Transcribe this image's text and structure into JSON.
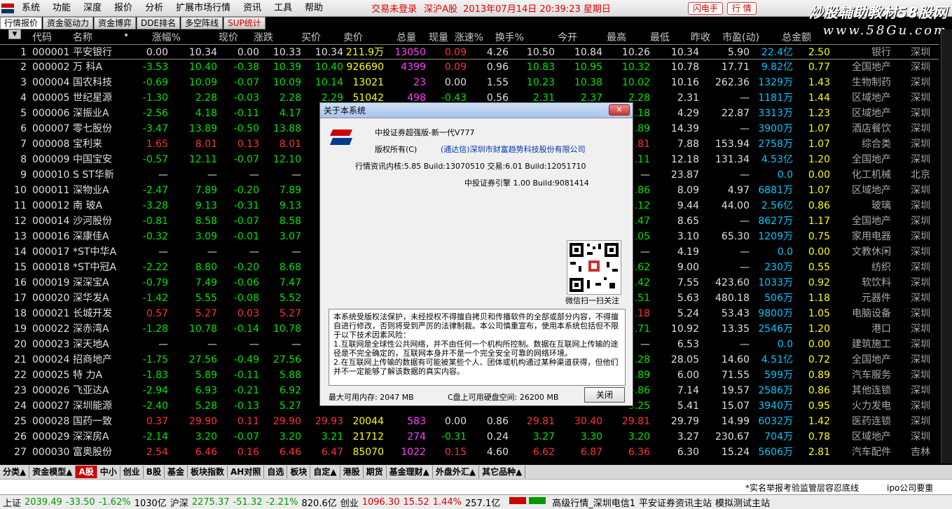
{
  "menubar": {
    "items": [
      "系统",
      "功能",
      "深度",
      "报价",
      "分析",
      "扩展市场行情",
      "资讯",
      "工具",
      "帮助"
    ],
    "login_status": "交易未登录",
    "market": "深沪A股",
    "datetime": "2013年07月14日  20:39:23 星期日",
    "btn_phone": "闪电手",
    "btn_quote": "行 情"
  },
  "brand": {
    "text": "炒股辅助教材58股网",
    "url": "www.58Gu.com"
  },
  "tabs": [
    {
      "label": "行情报价"
    },
    {
      "label": "资金驱动力"
    },
    {
      "label": "资金博弈"
    },
    {
      "label": "DDE排名"
    },
    {
      "label": "多空阵线"
    },
    {
      "label": "SUP统计"
    }
  ],
  "columns": [
    "代码",
    "名称",
    "•",
    "涨幅%",
    "现价",
    "涨跌",
    "买价",
    "卖价",
    "总量",
    "现量",
    "涨速%",
    "换手%",
    "今开",
    "最高",
    "最低",
    "昨收",
    "市盈(动)",
    "总金额"
  ],
  "stocks": [
    [
      "1",
      "000001",
      "平安银行",
      "0.00",
      "10.34",
      "0.00",
      "10.33",
      "10.34",
      "211.9万",
      "13050",
      "0.09",
      "4.26",
      "10.50",
      "10.84",
      "10.26",
      "10.34",
      "5.90",
      "22.4亿",
      "2.50",
      "银行",
      "深圳"
    ],
    [
      "2",
      "000002",
      "万  科A",
      "-3.53",
      "10.40",
      "-0.38",
      "10.39",
      "10.40",
      "926690",
      "4399",
      "0.09",
      "0.96",
      "10.83",
      "10.95",
      "10.32",
      "10.78",
      "17.71",
      "9.82亿",
      "0.77",
      "全国地产",
      "深圳"
    ],
    [
      "3",
      "000004",
      "国农科技",
      "-0.69",
      "10.09",
      "-0.07",
      "10.09",
      "10.14",
      "13021",
      "23",
      "0.00",
      "1.55",
      "10.23",
      "10.38",
      "10.02",
      "10.16",
      "262.36",
      "1329万",
      "1.43",
      "生物制药",
      "深圳"
    ],
    [
      "4",
      "000005",
      "世纪星源",
      "-1.30",
      "2.28",
      "-0.03",
      "2.28",
      "2.29",
      "51042",
      "498",
      "-0.43",
      "0.56",
      "2.31",
      "2.37",
      "2.28",
      "2.31",
      "—",
      "1181万",
      "1.44",
      "区域地产",
      "深圳"
    ],
    [
      "5",
      "000006",
      "深振业A",
      "-2.56",
      "4.18",
      "-0.11",
      "4.17",
      "",
      "",
      "",
      "",
      "",
      "",
      "",
      "4.18",
      "4.29",
      "22.87",
      "3313万",
      "1.23",
      "区域地产",
      "深圳"
    ],
    [
      "6",
      "000007",
      "零七股份",
      "-3.47",
      "13.89",
      "-0.50",
      "13.88",
      "",
      "",
      "",
      "",
      "",
      "",
      "",
      "13.89",
      "14.39",
      "—",
      "3900万",
      "1.07",
      "酒店餐饮",
      "深圳"
    ],
    [
      "7",
      "000008",
      "宝利来",
      "1.65",
      "8.01",
      "0.13",
      "8.01",
      "",
      "",
      "",
      "",
      "",
      "",
      "",
      "7.81",
      "7.88",
      "153.94",
      "2758万",
      "1.07",
      "综合类",
      "深圳"
    ],
    [
      "8",
      "000009",
      "中国宝安",
      "-0.57",
      "12.11",
      "-0.07",
      "12.10",
      "",
      "",
      "",
      "",
      "",
      "",
      "",
      "12.11",
      "12.18",
      "131.34",
      "4.53亿",
      "1.20",
      "全国地产",
      "深圳"
    ],
    [
      "9",
      "000010",
      "S ST华新",
      "—",
      "—",
      "—",
      "—",
      "",
      "",
      "",
      "",
      "",
      "",
      "",
      "—",
      "23.87",
      "—",
      "0.0",
      "0.00",
      "化工机械",
      "北京"
    ],
    [
      "10",
      "000011",
      "深物业A",
      "-2.47",
      "7.89",
      "-0.20",
      "7.89",
      "",
      "",
      "",
      "",
      "",
      "",
      "",
      "7.86",
      "8.09",
      "4.97",
      "6881万",
      "1.07",
      "区域地产",
      "深圳"
    ],
    [
      "11",
      "000012",
      "南  玻A",
      "-3.28",
      "9.13",
      "-0.31",
      "9.13",
      "",
      "",
      "",
      "",
      "",
      "",
      "",
      "9.12",
      "9.44",
      "44.00",
      "2.56亿",
      "0.86",
      "玻璃",
      "深圳"
    ],
    [
      "12",
      "000014",
      "沙河股份",
      "-0.81",
      "8.58",
      "-0.07",
      "8.58",
      "",
      "",
      "",
      "",
      "",
      "",
      "",
      "8.47",
      "8.65",
      "—",
      "8627万",
      "1.17",
      "全国地产",
      "深圳"
    ],
    [
      "13",
      "000016",
      "深康佳A",
      "-0.32",
      "3.09",
      "-0.01",
      "3.07",
      "",
      "",
      "",
      "",
      "",
      "",
      "",
      "3.05",
      "3.10",
      "65.30",
      "1209万",
      "0.75",
      "家用电器",
      "深圳"
    ],
    [
      "14",
      "000017",
      "*ST中华A",
      "—",
      "—",
      "—",
      "—",
      "",
      "",
      "",
      "",
      "",
      "",
      "",
      "—",
      "4.19",
      "—",
      "0.0",
      "0.00",
      "文教休闲",
      "深圳"
    ],
    [
      "15",
      "000018",
      "*ST中冠A",
      "-2.22",
      "8.80",
      "-0.20",
      "8.68",
      "",
      "",
      "",
      "",
      "",
      "",
      "",
      "8.62",
      "9.00",
      "—",
      "230万",
      "0.55",
      "纺织",
      "深圳"
    ],
    [
      "16",
      "000019",
      "深深宝A",
      "-0.79",
      "7.49",
      "-0.06",
      "7.47",
      "",
      "",
      "",
      "",
      "",
      "",
      "",
      "7.42",
      "7.55",
      "423.60",
      "1033万",
      "0.92",
      "软饮料",
      "深圳"
    ],
    [
      "17",
      "000020",
      "深华发A",
      "-1.42",
      "5.55",
      "-0.08",
      "5.52",
      "",
      "",
      "",
      "",
      "",
      "",
      "",
      "5.51",
      "5.63",
      "480.18",
      "506万",
      "1.18",
      "元器件",
      "深圳"
    ],
    [
      "18",
      "000021",
      "长城开发",
      "0.57",
      "5.27",
      "0.03",
      "5.27",
      "",
      "",
      "",
      "",
      "",
      "",
      "",
      "5.18",
      "5.24",
      "53.43",
      "9800万",
      "1.05",
      "电脑设备",
      "深圳"
    ],
    [
      "19",
      "000022",
      "深赤湾A",
      "-1.28",
      "10.78",
      "-0.14",
      "10.78",
      "",
      "",
      "",
      "",
      "",
      "",
      "",
      "10.71",
      "10.92",
      "13.35",
      "2546万",
      "1.20",
      "港口",
      "深圳"
    ],
    [
      "20",
      "000023",
      "深天地A",
      "—",
      "—",
      "—",
      "—",
      "",
      "",
      "",
      "",
      "",
      "",
      "",
      "—",
      "6.53",
      "—",
      "0.0",
      "0.00",
      "建筑施工",
      "深圳"
    ],
    [
      "21",
      "000024",
      "招商地产",
      "-1.75",
      "27.56",
      "-0.49",
      "27.56",
      "",
      "",
      "",
      "",
      "",
      "",
      "",
      "27.28",
      "28.05",
      "14.60",
      "4.51亿",
      "0.72",
      "全国地产",
      "深圳"
    ],
    [
      "22",
      "000025",
      "特  力A",
      "-1.83",
      "5.89",
      "-0.11",
      "5.88",
      "",
      "",
      "",
      "",
      "",
      "",
      "",
      "5.89",
      "6.00",
      "71.55",
      "599万",
      "0.89",
      "汽车服务",
      "深圳"
    ],
    [
      "23",
      "000026",
      "飞亚达A",
      "-2.94",
      "6.93",
      "-0.21",
      "6.92",
      "",
      "",
      "",
      "",
      "",
      "",
      "",
      "6.86",
      "7.14",
      "19.57",
      "2586万",
      "0.86",
      "其他连锁",
      "深圳"
    ],
    [
      "24",
      "000027",
      "深圳能源",
      "-2.40",
      "5.28",
      "-0.13",
      "5.27",
      "",
      "",
      "",
      "",
      "",
      "",
      "",
      "5.25",
      "5.41",
      "15.07",
      "3940万",
      "0.95",
      "火力发电",
      "深圳"
    ],
    [
      "25",
      "000028",
      "国药一致",
      "0.37",
      "29.90",
      "0.11",
      "29.90",
      "29.93",
      "20044",
      "583",
      "0.00",
      "0.86",
      "29.81",
      "30.40",
      "29.81",
      "29.79",
      "14.99",
      "6032万",
      "1.42",
      "医药连锁",
      "深圳"
    ],
    [
      "26",
      "000029",
      "深深房A",
      "-2.14",
      "3.20",
      "-0.07",
      "3.20",
      "3.21",
      "21712",
      "274",
      "-0.31",
      "0.24",
      "3.27",
      "3.30",
      "3.20",
      "3.27",
      "230.67",
      "704万",
      "0.78",
      "区域地产",
      "深圳"
    ],
    [
      "27",
      "000030",
      "富奥股份",
      "2.54",
      "6.46",
      "0.16",
      "6.46",
      "6.47",
      "85070",
      "1022",
      "0.15",
      "4.60",
      "6.62",
      "6.87",
      "6.36",
      "6.30",
      "15.24",
      "5606万",
      "2.81",
      "汽车配件",
      "吉林"
    ]
  ],
  "dialog": {
    "title": "关于本系统",
    "product": "中投证券超强版-新一代V777",
    "copyright_label": "版权所有(C)",
    "copyright_holder": "(通达信)深圳市财富趋势科技股份有限公司",
    "version_line": "行情资讯内核:5.85 Build:13070510 交易:6.01 Build:12051710",
    "engine_line": "中投证券引擎 1.00 Build:9081414",
    "qr_caption": "微信扫一扫关注",
    "notice": "本系统受版权法保护，未经授权不得擅自拷贝和传播软件的全部或部分内容，不得擅自进行修改，否则将受到严厉的法律制裁。本公司慎重宣布，使用本系统包括但不限于以下技术因素风险：\n1.互联网是全球性公共网络，并不由任何一个机构所控制。数据在互联网上传输的途径是不完全确定的，互联网本身并不是一个完全安全可靠的网络环境。\n2.在互联网上传输的数据有可能被某些个人、团体或机构通过某种渠道获得，但他们并不一定能够了解该数据的真实内容。",
    "memory": "最大可用内存:   2047 MB",
    "disk": "C盘上可用硬盘空间:   26200 MB",
    "close_label": "关闭"
  },
  "bottom_tabs": [
    "分类▲",
    "资金模型▲",
    "A股",
    "中小",
    "创业",
    "B股",
    "基金",
    "板块指数",
    "AH对照",
    "自选",
    "板块",
    "自定▲",
    "港股",
    "期货",
    "基金理财▲",
    "外盘外汇▲",
    "其它品种▲"
  ],
  "news": [
    "*实名举报考验监管层容忍底线",
    "ipo公司要重"
  ],
  "ticker": {
    "sh_label": "上证",
    "sh_value": "2039.49",
    "sh_change": "-33.50",
    "sh_pct": "-1.62%",
    "sh_amt": "1030亿",
    "hs_label": "沪深",
    "hs_value": "2275.37",
    "hs_change": "-51.32",
    "hs_pct": "-2.21%",
    "hs_amt": "820.6亿",
    "cy_label": "创业",
    "cy_value": "1096.30",
    "cy_change": "15.52",
    "cy_pct": "1.44%",
    "cy_amt": "257.1亿",
    "server": "高级行情_深圳电信1",
    "broker": "平安证券资讯主站",
    "mode": "模拟测试主站"
  },
  "colors": {
    "up": "#ff3232",
    "down": "#00e600",
    "accent": "#ffff00"
  }
}
